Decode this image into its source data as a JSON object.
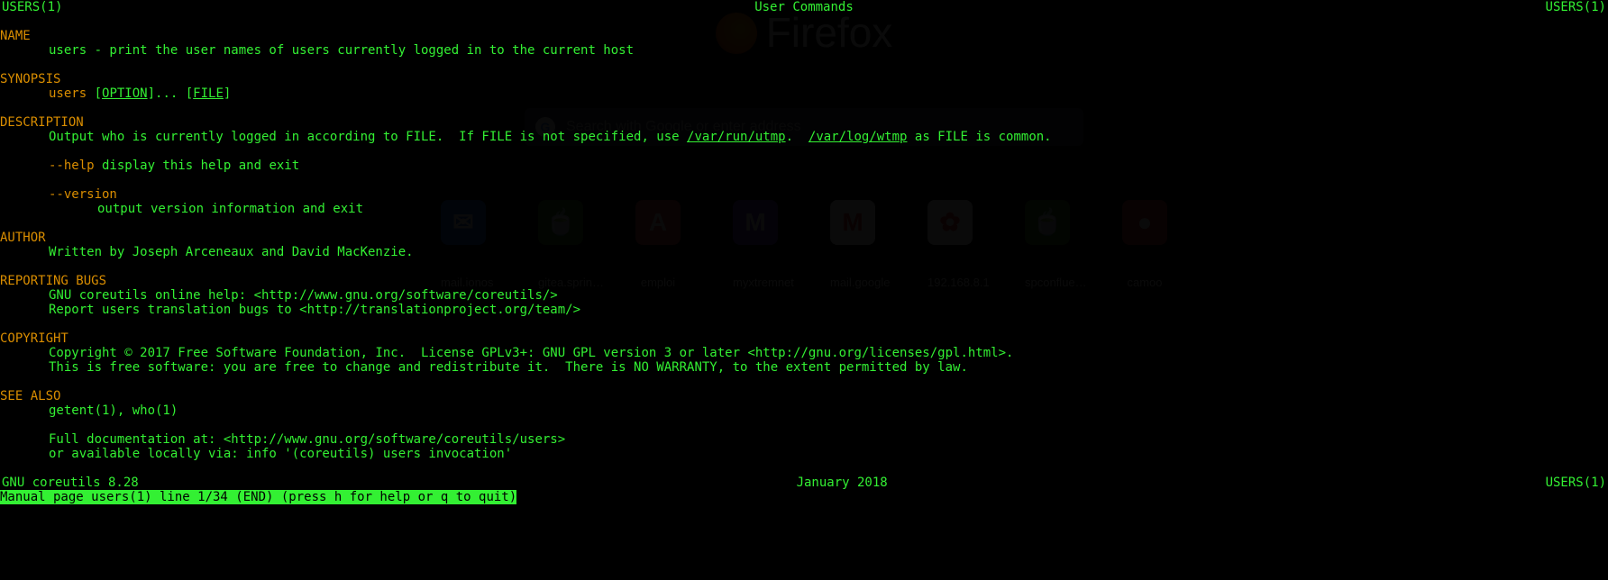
{
  "header": {
    "left": "USERS(1)",
    "center": "User Commands",
    "right": "USERS(1)"
  },
  "sections": {
    "name_hdr": "NAME",
    "name_body": "users - print the user names of users currently logged in to the current host",
    "synopsis_hdr": "SYNOPSIS",
    "synopsis_cmd": "users",
    "synopsis_opt": "OPTION",
    "synopsis_file": "FILE",
    "desc_hdr": "DESCRIPTION",
    "desc_pre": "Output who is currently logged in according to FILE.  If FILE is not specified, use ",
    "desc_path1": "/var/run/utmp",
    "desc_mid": ".  ",
    "desc_path2": "/var/log/wtmp",
    "desc_post": " as FILE is common.",
    "help_flag": "--help",
    "help_text": " display this help and exit",
    "version_flag": "--version",
    "version_text": "output version information and exit",
    "author_hdr": "AUTHOR",
    "author_body": "Written by Joseph Arceneaux and David MacKenzie.",
    "bugs_hdr": "REPORTING BUGS",
    "bugs_l1": "GNU coreutils online help: <http://www.gnu.org/software/coreutils/>",
    "bugs_l2": "Report users translation bugs to <http://translationproject.org/team/>",
    "copy_hdr": "COPYRIGHT",
    "copy_l1": "Copyright © 2017 Free Software Foundation, Inc.  License GPLv3+: GNU GPL version 3 or later <http://gnu.org/licenses/gpl.html>.",
    "copy_l2": "This is free software: you are free to change and redistribute it.  There is NO WARRANTY, to the extent permitted by law.",
    "see_hdr": "SEE ALSO",
    "see_l1": "getent(1), who(1)",
    "see_l2": "Full documentation at: <http://www.gnu.org/software/coreutils/users>",
    "see_l3": "or available locally via: info '(coreutils) users invocation'"
  },
  "footer": {
    "left": "GNU coreutils 8.28",
    "center": "January 2018",
    "right": "USERS(1)"
  },
  "status": "Manual page users(1) line 1/34 (END) (press h for help or q to quit)",
  "background": {
    "brand": "Firefox",
    "search_placeholder": "Search with Google or enter address",
    "tiles": [
      {
        "glyph": "✉",
        "bg": "#2f6fd6",
        "label": "mail.ionos"
      },
      {
        "glyph": "🍵",
        "bg": "#3a7a2a",
        "label": "gitea.sprin…"
      },
      {
        "glyph": "A",
        "bg": "#d64848",
        "label": "emploi"
      },
      {
        "glyph": "M",
        "bg": "#6a3fbf",
        "label": "myxtremnet"
      },
      {
        "glyph": "M",
        "bg": "#ffffff",
        "label": "mail.google"
      },
      {
        "glyph": "✿",
        "bg": "#ffffff",
        "label": "192.168.8.1"
      },
      {
        "glyph": "🍵",
        "bg": "#3a7a2a",
        "label": "spconflue…"
      },
      {
        "glyph": "●",
        "bg": "#c23030",
        "label": "camoo"
      }
    ]
  }
}
